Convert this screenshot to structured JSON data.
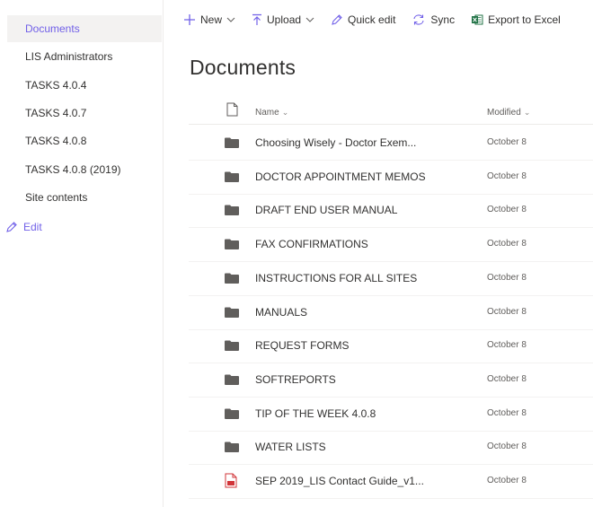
{
  "sidebar": {
    "items": [
      {
        "label": "Documents",
        "selected": true
      },
      {
        "label": "LIS Administrators",
        "selected": false
      },
      {
        "label": "TASKS 4.0.4",
        "selected": false
      },
      {
        "label": "TASKS 4.0.7",
        "selected": false
      },
      {
        "label": "TASKS 4.0.8",
        "selected": false
      },
      {
        "label": "TASKS 4.0.8 (2019)",
        "selected": false
      },
      {
        "label": "Site contents",
        "selected": false
      }
    ],
    "edit_label": "Edit"
  },
  "toolbar": {
    "new_label": "New",
    "upload_label": "Upload",
    "quick_edit_label": "Quick edit",
    "sync_label": "Sync",
    "export_label": "Export to Excel"
  },
  "page": {
    "title": "Documents"
  },
  "list": {
    "columns": {
      "name": "Name",
      "modified": "Modified"
    },
    "rows": [
      {
        "name": "Choosing Wisely - Doctor Exem...",
        "modified": "October 8",
        "type": "folder"
      },
      {
        "name": "DOCTOR APPOINTMENT MEMOS",
        "modified": "October 8",
        "type": "folder"
      },
      {
        "name": "DRAFT END USER MANUAL",
        "modified": "October 8",
        "type": "folder"
      },
      {
        "name": "FAX CONFIRMATIONS",
        "modified": "October 8",
        "type": "folder"
      },
      {
        "name": "INSTRUCTIONS FOR ALL SITES",
        "modified": "October 8",
        "type": "folder"
      },
      {
        "name": "MANUALS",
        "modified": "October 8",
        "type": "folder"
      },
      {
        "name": "REQUEST FORMS",
        "modified": "October 8",
        "type": "folder"
      },
      {
        "name": "SOFTREPORTS",
        "modified": "October 8",
        "type": "folder"
      },
      {
        "name": "TIP OF THE WEEK 4.0.8",
        "modified": "October 8",
        "type": "folder"
      },
      {
        "name": "WATER LISTS",
        "modified": "October 8",
        "type": "folder"
      },
      {
        "name": "SEP 2019_LIS Contact Guide_v1...",
        "modified": "October 8",
        "type": "pdf"
      }
    ]
  },
  "colors": {
    "accent": "#7160e8",
    "excel": "#217346",
    "pdf": "#d13438",
    "folder": "#605e5c"
  }
}
